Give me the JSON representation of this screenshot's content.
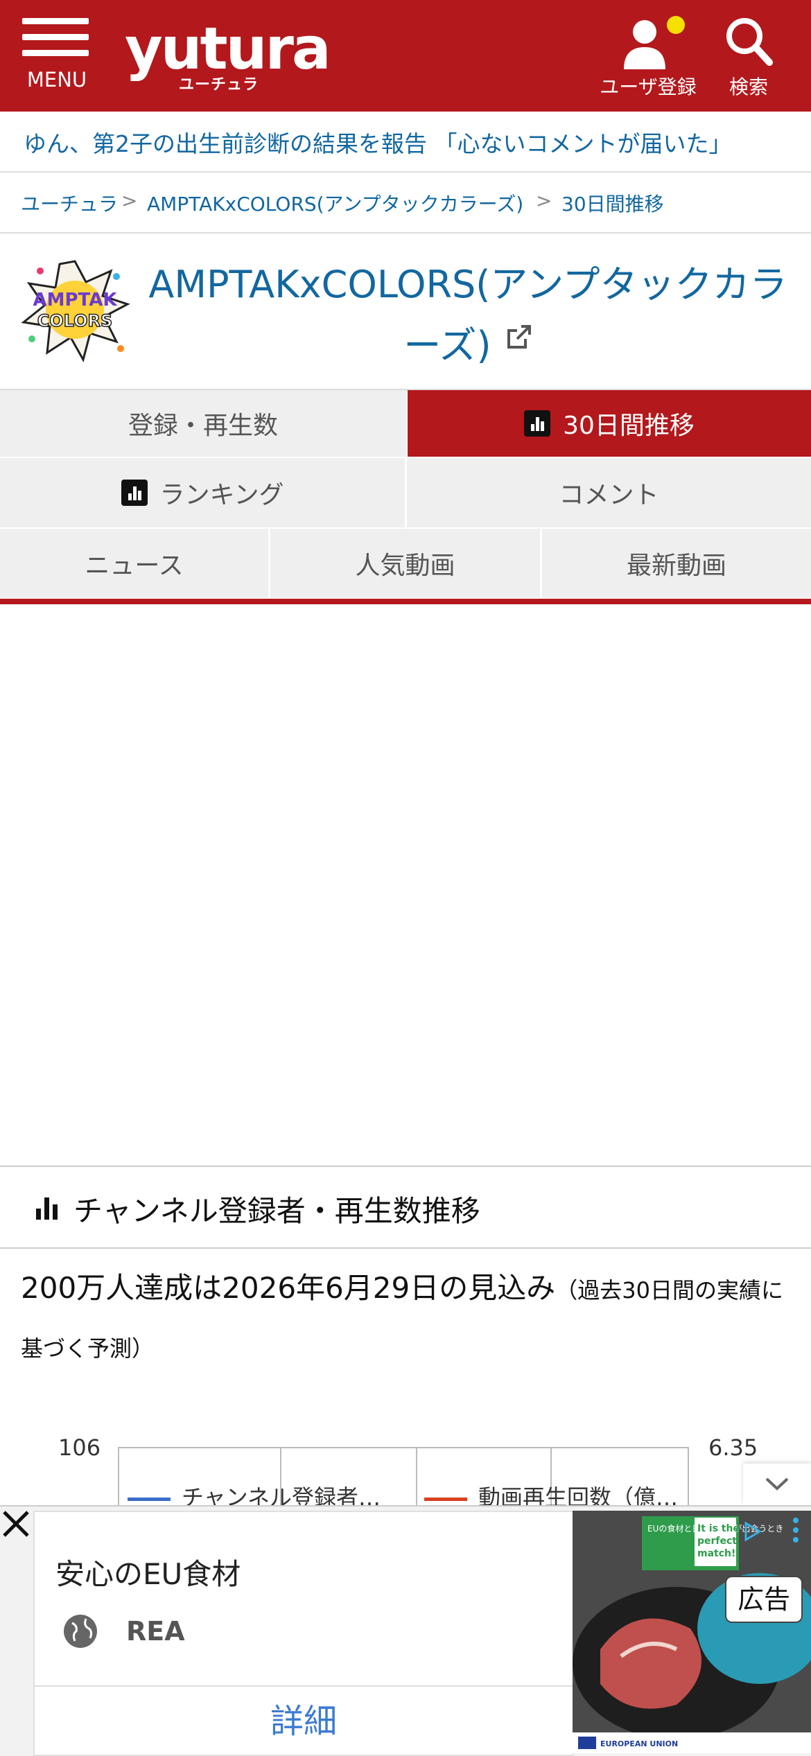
{
  "header": {
    "menu_label": "MENU",
    "logo_text": "yutura",
    "logo_sub": "ユーチュラ",
    "user_label": "ユーザ登録",
    "search_label": "検索",
    "colors": {
      "brand": "#b3181c",
      "notify_dot": "#f5e000"
    }
  },
  "news_ticker": "ゆん、第2子の出生前診断の結果を報告 「心ないコメントが届いた」",
  "breadcrumb": [
    {
      "label": "ユーチュラ"
    },
    {
      "label": "AMPTAKxCOLORS(アンプタックカラーズ)"
    },
    {
      "label": "30日間推移"
    }
  ],
  "breadcrumb_sep": ">",
  "channel": {
    "name": "AMPTAKxCOLORS(アンプタックカラーズ)",
    "thumbnail_text": "AMPTAK COLORS"
  },
  "tabs": {
    "row1": [
      "登録・再生数",
      "30日間推移"
    ],
    "row2": [
      "ランキング",
      "コメント"
    ],
    "row3": [
      "ニュース",
      "人気動画",
      "最新動画"
    ],
    "active": "30日間推移"
  },
  "section": {
    "title": "チャンネル登録者・再生数推移",
    "forecast_main": "200万人達成は2026年6月29日の見込み",
    "forecast_note": "（過去30日間の実績に基づく予測）"
  },
  "chart": {
    "y_left_top": "106",
    "y_right_top": "6.35",
    "legend": [
      {
        "label": "チャンネル登録者…",
        "color": "#3a6ec8"
      },
      {
        "label": "動画再生回数（億…",
        "color": "#d9411e"
      }
    ]
  },
  "ad": {
    "headline": "安心のEU食材",
    "advertiser": "REA",
    "cta": "詳細",
    "tag": "広告",
    "image_texts": [
      "EUの食材と日本の食材が出会うとき",
      "It is the perfect match!",
      "EUROPEAN UNION"
    ]
  }
}
